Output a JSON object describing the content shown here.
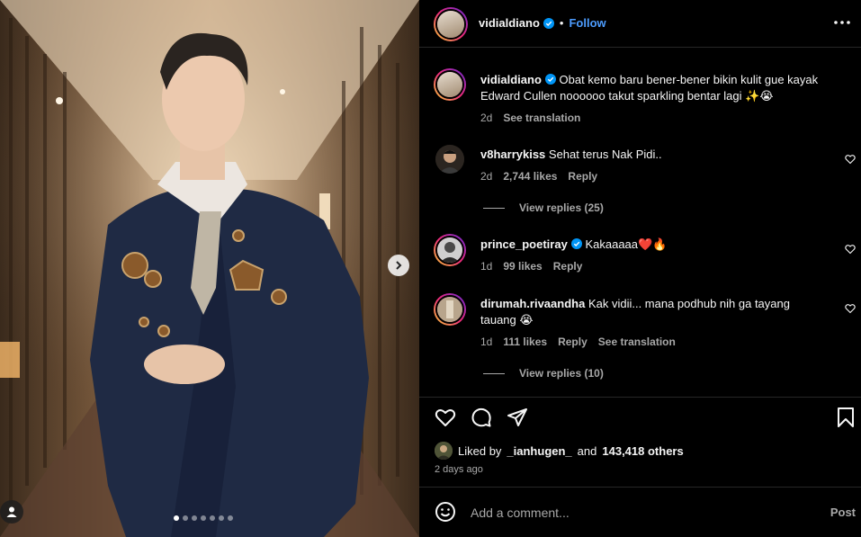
{
  "post": {
    "author": "vidialdiano",
    "follow_label": "Follow",
    "caption": {
      "username": "vidialdiano",
      "text": "Obat kemo baru bener-bener bikin kulit gue kayak Edward Cullen noooooo takut sparkling bentar lagi ✨😭",
      "time": "2d",
      "see_translation": "See translation"
    },
    "comments": [
      {
        "username": "v8harrykiss",
        "text": "Sehat terus Nak Pidi..",
        "time": "2d",
        "likes": "2,744 likes",
        "reply": "Reply",
        "view_replies": "View replies (25)"
      },
      {
        "username": "prince_poetiray",
        "text": "Kakaaaaa❤️🔥",
        "time": "1d",
        "likes": "99 likes",
        "reply": "Reply"
      },
      {
        "username": "dirumah.rivaandha",
        "text": "Kak vidii... mana podhub nih ga tayang tauang 😭",
        "time": "1d",
        "likes": "111 likes",
        "reply": "Reply",
        "see_translation": "See translation",
        "view_replies": "View replies (10)"
      }
    ],
    "liked_by": {
      "prefix": "Liked by",
      "user": "_ianhugen_",
      "and": "and",
      "others": "143,418 others"
    },
    "date": "2 days ago",
    "add_comment_placeholder": "Add a comment...",
    "post_label": "Post",
    "carousel": {
      "total": 7,
      "active": 0
    }
  },
  "icons": {
    "verified": "verified-badge-icon",
    "more": "more-horizontal-icon",
    "like": "heart-icon",
    "comment": "comment-icon",
    "share": "share-icon",
    "save": "bookmark-icon",
    "emoji": "emoji-icon",
    "next": "chevron-right-icon",
    "tag": "user-tag-icon"
  },
  "colors": {
    "accent": "#4d9dff",
    "background": "#000000",
    "muted": "#a8a8a8"
  }
}
